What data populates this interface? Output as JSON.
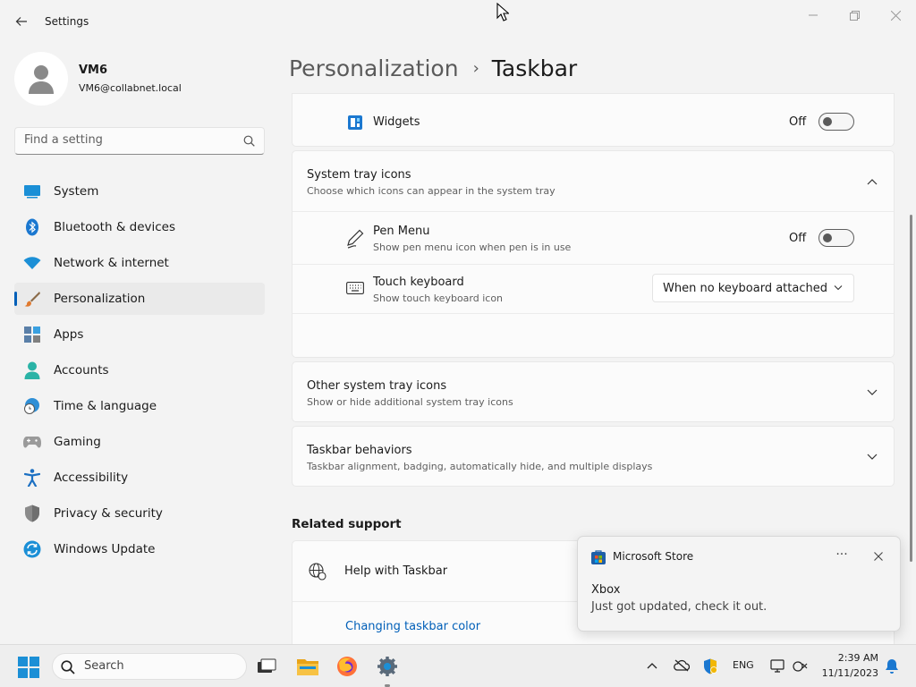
{
  "window": {
    "title": "Settings"
  },
  "user": {
    "name": "VM6",
    "email": "VM6@collabnet.local"
  },
  "search": {
    "placeholder": "Find a setting"
  },
  "sidebar": {
    "items": [
      {
        "label": "System",
        "icon": "system-icon"
      },
      {
        "label": "Bluetooth & devices",
        "icon": "bluetooth-icon"
      },
      {
        "label": "Network & internet",
        "icon": "wifi-icon"
      },
      {
        "label": "Personalization",
        "icon": "brush-icon"
      },
      {
        "label": "Apps",
        "icon": "apps-icon"
      },
      {
        "label": "Accounts",
        "icon": "accounts-icon"
      },
      {
        "label": "Time & language",
        "icon": "globe-clock-icon"
      },
      {
        "label": "Gaming",
        "icon": "gamepad-icon"
      },
      {
        "label": "Accessibility",
        "icon": "accessibility-icon"
      },
      {
        "label": "Privacy & security",
        "icon": "shield-icon"
      },
      {
        "label": "Windows Update",
        "icon": "update-icon"
      }
    ],
    "active": "Personalization"
  },
  "breadcrumb": {
    "parent": "Personalization",
    "separator": "›",
    "current": "Taskbar"
  },
  "widgets": {
    "label": "Widgets",
    "state": "Off"
  },
  "system_tray": {
    "title": "System tray icons",
    "subtitle": "Choose which icons can appear in the system tray",
    "pen_menu": {
      "title": "Pen Menu",
      "subtitle": "Show pen menu icon when pen is in use",
      "state": "Off"
    },
    "touch_keyboard": {
      "title": "Touch keyboard",
      "subtitle": "Show touch keyboard icon",
      "selected": "When no keyboard attached"
    }
  },
  "other_tray": {
    "title": "Other system tray icons",
    "subtitle": "Show or hide additional system tray icons"
  },
  "behaviors": {
    "title": "Taskbar behaviors",
    "subtitle": "Taskbar alignment, badging, automatically hide, and multiple displays"
  },
  "related": {
    "heading": "Related support",
    "help_label": "Help with Taskbar",
    "link_label": "Changing taskbar color"
  },
  "toast": {
    "app": "Microsoft Store",
    "more": "···",
    "title": "Xbox",
    "body": "Just got updated, check it out."
  },
  "taskbar": {
    "search_label": "Search",
    "language": "ENG",
    "time": "2:39 AM",
    "date": "11/11/2023"
  },
  "colors": {
    "accent": "#005fb8",
    "background": "#f3f3f3",
    "card": "#fbfbfb"
  }
}
